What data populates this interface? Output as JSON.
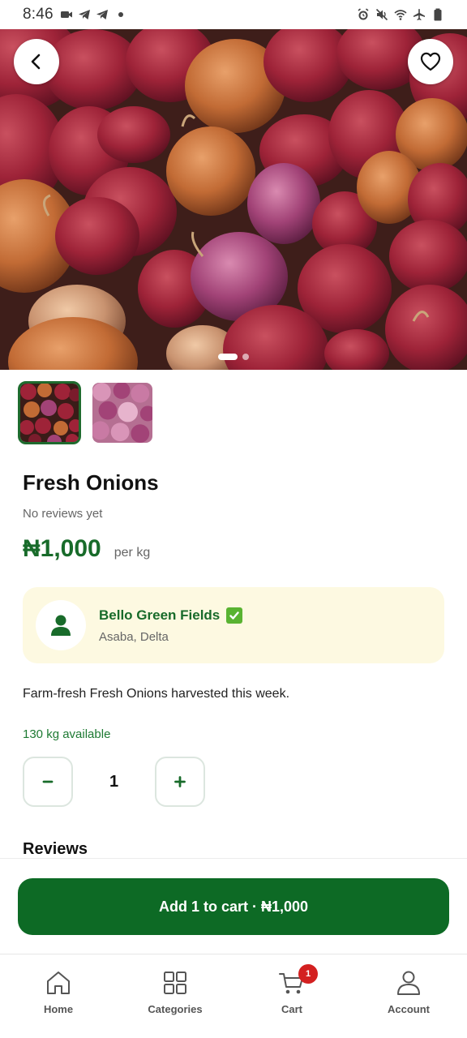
{
  "status_bar": {
    "time": "8:46",
    "left_icons": [
      "video-icon",
      "telegram-icon",
      "telegram-icon",
      "dot-icon"
    ],
    "right_icons": [
      "alarm-icon",
      "mute-icon",
      "wifi-icon",
      "airplane-icon",
      "battery-icon"
    ]
  },
  "gallery": {
    "image_count": 2,
    "active_index": 0
  },
  "product": {
    "title": "Fresh Onions",
    "reviews_note": "No reviews yet",
    "price": "₦1,000",
    "unit": "per kg",
    "description": "Farm-fresh Fresh Onions harvested this week.",
    "stock": "130 kg available"
  },
  "seller": {
    "name": "Bello Green Fields",
    "location": "Asaba, Delta"
  },
  "quantity": {
    "value": "1",
    "decrement_label": "−",
    "increment_label": "+"
  },
  "reviews": {
    "heading": "Reviews"
  },
  "cart_button": {
    "label": "Add 1 to cart · ₦1,000"
  },
  "nav": {
    "items": [
      {
        "label": "Home",
        "icon": "home-icon"
      },
      {
        "label": "Categories",
        "icon": "grid-icon"
      },
      {
        "label": "Cart",
        "icon": "cart-icon",
        "badge": "1"
      },
      {
        "label": "Account",
        "icon": "user-icon"
      }
    ]
  },
  "colors": {
    "primary_green": "#0d6a25",
    "price_green": "#186b2a",
    "seller_card_bg": "#fdf9e1",
    "badge_red": "#d32020"
  }
}
